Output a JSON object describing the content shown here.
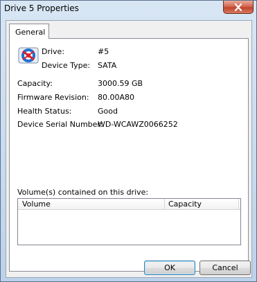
{
  "window": {
    "title": "Drive 5 Properties",
    "close_glyph": "✕"
  },
  "tabs": [
    {
      "label": "General"
    }
  ],
  "header": {
    "drive_label": "Drive:",
    "drive_value": "#5",
    "type_label": "Device Type:",
    "type_value": "SATA",
    "icon": "drive-icon"
  },
  "details": [
    {
      "label": "Capacity:",
      "value": "3000.59 GB"
    },
    {
      "label": "Firmware Revision:",
      "value": "80.00A80"
    },
    {
      "label": "Health Status:",
      "value": "Good"
    },
    {
      "label": "Device Serial Number:",
      "value": "WD-WCAWZ0066252"
    }
  ],
  "volumes": {
    "caption": "Volume(s) contained on this drive:",
    "columns": [
      "Volume",
      "Capacity"
    ],
    "rows": []
  },
  "buttons": {
    "ok": "OK",
    "cancel": "Cancel"
  }
}
